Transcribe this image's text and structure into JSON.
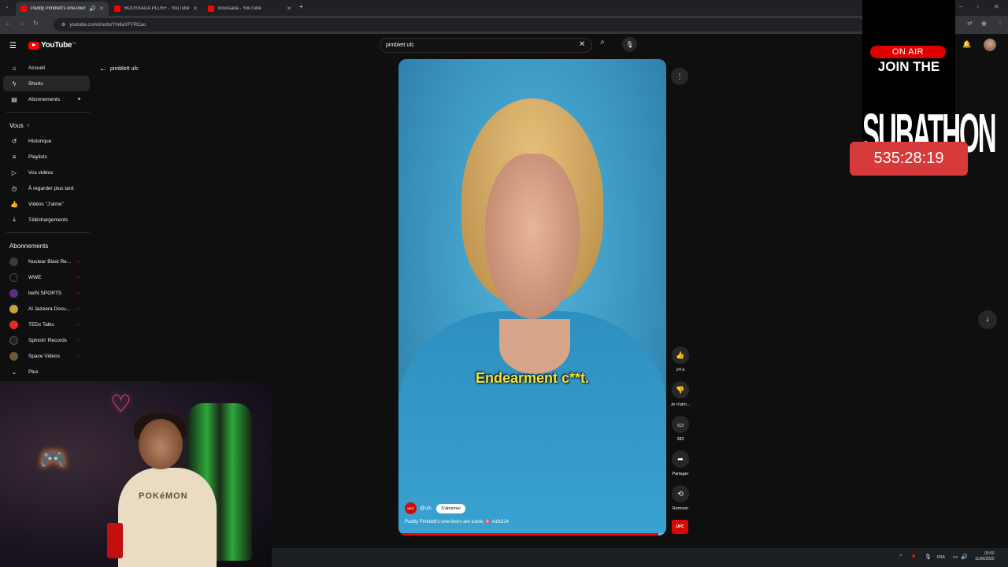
{
  "browser": {
    "tabs": [
      {
        "title": "Paddy Pimblett's one-liners",
        "active": true
      },
      {
        "title": "BOUSSADA PLUS+ - YouTube",
        "active": false
      },
      {
        "title": "boussada - YouTube",
        "active": false
      }
    ],
    "new_tab": "+",
    "url": "youtube.com/shorts/Ym6aYFYRCao"
  },
  "youtube": {
    "logo_text": "YouTube",
    "logo_tm": "TN",
    "search_value": "pimblett ufc"
  },
  "sidebar": {
    "main": [
      {
        "label": "Accueil",
        "icon": "home-icon",
        "glyph": "⌂"
      },
      {
        "label": "Shorts",
        "icon": "shorts-icon",
        "glyph": "ϟ"
      },
      {
        "label": "Abonnements",
        "icon": "subscriptions-icon",
        "glyph": "▤"
      }
    ],
    "you_header": "Vous",
    "you": [
      {
        "label": "Historique",
        "icon": "history-icon",
        "glyph": "↺"
      },
      {
        "label": "Playlists",
        "icon": "playlists-icon",
        "glyph": "≡"
      },
      {
        "label": "Vos vidéos",
        "icon": "your-videos-icon",
        "glyph": "▷"
      },
      {
        "label": "À regarder plus tard",
        "icon": "watch-later-icon",
        "glyph": "◷"
      },
      {
        "label": "Vidéos \"J'aime\"",
        "icon": "liked-videos-icon",
        "glyph": "👍"
      },
      {
        "label": "Téléchargements",
        "icon": "downloads-icon",
        "glyph": "⤓"
      }
    ],
    "subs_header": "Abonnements",
    "subs": [
      {
        "label": "Nuclear Blast Re...",
        "color": "#3a3a3a"
      },
      {
        "label": "WWE",
        "color": "#111111"
      },
      {
        "label": "beIN SPORTS",
        "color": "#5a2d8c"
      },
      {
        "label": "Al Jazeera Docu...",
        "color": "#c8a23c"
      },
      {
        "label": "TEDx Talks",
        "color": "#e62b1e"
      },
      {
        "label": "Spinnin' Records",
        "color": "#222222"
      },
      {
        "label": "Space Videos",
        "color": "#6b5a3a"
      }
    ],
    "more_label": "Plus"
  },
  "shorts": {
    "back_query": "pimblett ufc",
    "subtitle": "Endearment c**t.",
    "channel_badge": "UFC",
    "handle": "@ufc",
    "subscribe_label": "S'abonner",
    "caption": "Paddy Pimblett's one-liners are iconic 🎯 #ufc314",
    "progress": 0.97,
    "actions": {
      "likes": "24 k",
      "dislike": "Je n'aim...",
      "comments": "382",
      "share": "Partager",
      "remix": "Remixer"
    },
    "thumb_label": "UFC"
  },
  "overlay": {
    "on_air": "ON AIR",
    "join": "JOIN THE",
    "subathon": "SUBATHON",
    "timer": "535:28:19"
  },
  "webcam": {
    "shirt_text": "POKéMON"
  },
  "taskbar": {
    "lang": "FRA",
    "time": "03:50",
    "date": "11/06/2025"
  }
}
